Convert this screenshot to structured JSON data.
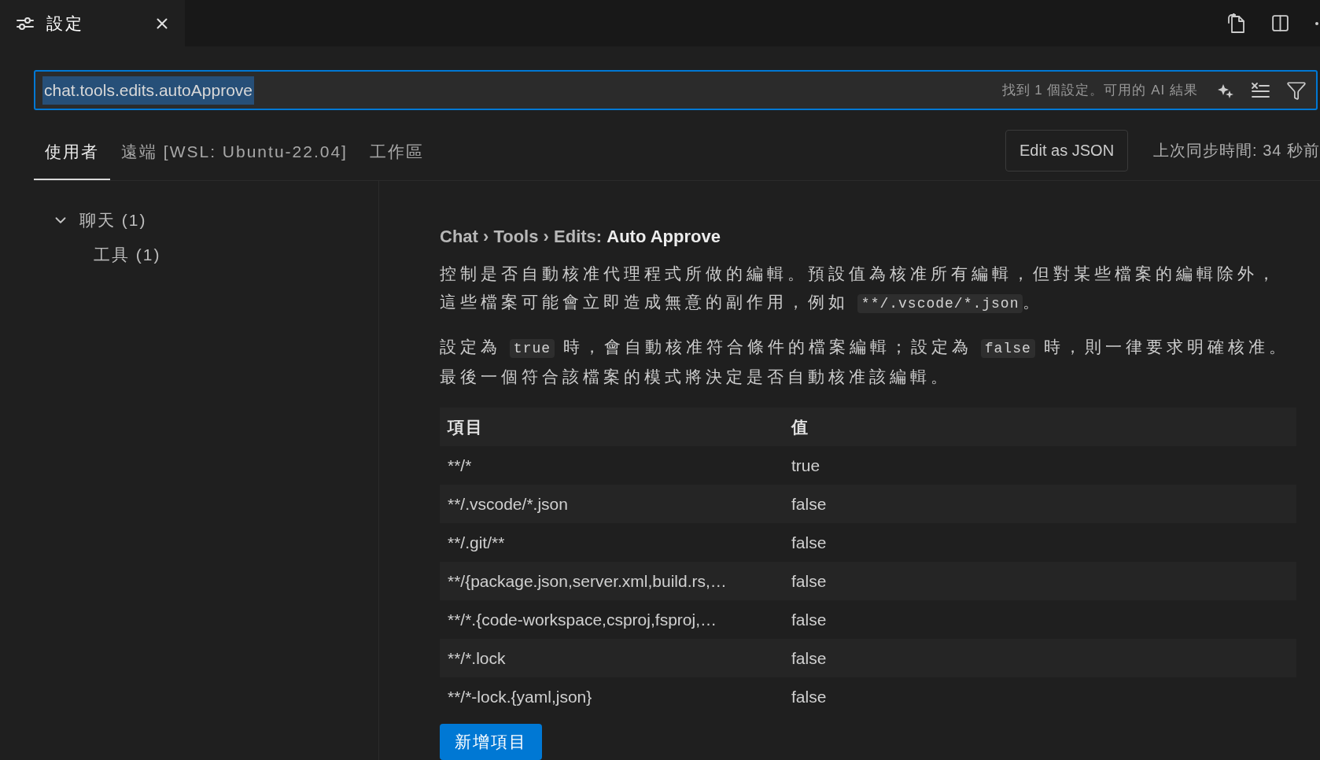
{
  "editor_tabs": [
    {
      "label": "設定",
      "selected": true
    }
  ],
  "search": {
    "value": "chat.tools.edits.autoApprove",
    "value_selected": true,
    "result_text": "找到 1 個設定。可用的 AI 結果"
  },
  "scope_tabs": [
    {
      "label": "使用者",
      "selected": true
    },
    {
      "label": "遠端 [WSL: Ubuntu-22.04]",
      "selected": false
    },
    {
      "label": "工作區",
      "selected": false
    }
  ],
  "edit_json_button": "Edit as JSON",
  "sync_status": "上次同步時間: 34 秒前",
  "toc": [
    {
      "label": "聊天 (1)",
      "expanded": true,
      "children": [
        {
          "label": "工具 (1)"
        }
      ]
    }
  ],
  "setting": {
    "title": "Chat › Tools › Edits: **Auto Approve**",
    "description": [
      [
        {
          "kind": "text",
          "text": "控制是否自動核准代理程式所做的編輯。預設值為核准所有編輯，但對某些檔案的編輯除外，這些檔案可能會立即造成無意的副作用，例如 "
        },
        {
          "kind": "code",
          "text": "**/.vscode/*.json"
        },
        {
          "kind": "text",
          "text": "。"
        }
      ],
      [
        {
          "kind": "text",
          "text": "設定為 "
        },
        {
          "kind": "code",
          "text": "true"
        },
        {
          "kind": "text",
          "text": " 時，會自動核准符合條件的檔案編輯；設定為 "
        },
        {
          "kind": "code",
          "text": "false"
        },
        {
          "kind": "text",
          "text": " 時，則一律要求明確核准。最後一個符合該檔案的模式將決定是否自動核准該編輯。"
        }
      ]
    ],
    "table": {
      "columns": [
        "項目",
        "值"
      ],
      "rows": [
        {
          "item": "**/*",
          "value": "true"
        },
        {
          "item": "**/.vscode/*.json",
          "value": "false"
        },
        {
          "item": "**/.git/**",
          "value": "false"
        },
        {
          "item": "**/{package.json,server.xml,build.rs,…",
          "value": "false"
        },
        {
          "item": "**/*.{code-workspace,csproj,fsproj,…",
          "value": "false"
        },
        {
          "item": "**/*.lock",
          "value": "false"
        },
        {
          "item": "**/*-lock.{yaml,json}",
          "value": "false"
        }
      ]
    },
    "add_button": "新增項目"
  }
}
